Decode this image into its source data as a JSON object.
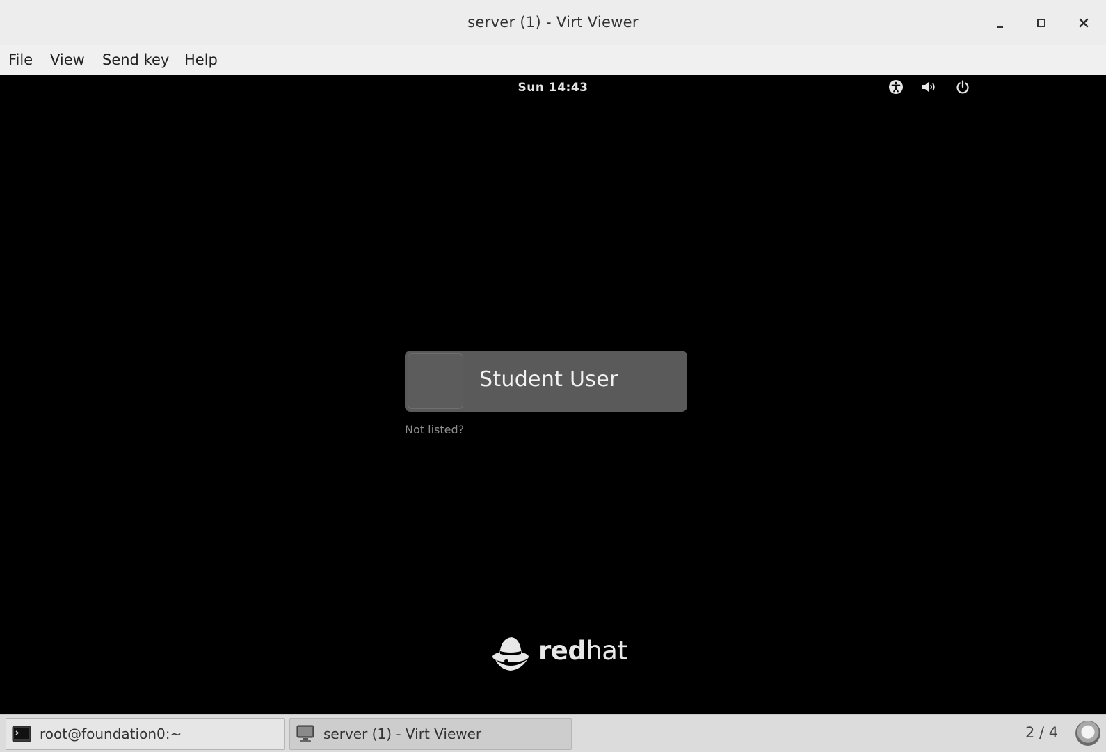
{
  "window": {
    "title": "server (1) - Virt Viewer"
  },
  "menubar": {
    "items": [
      "File",
      "View",
      "Send key",
      "Help"
    ]
  },
  "guest": {
    "clock": "Sun 14:43",
    "status_icons": [
      "accessibility-icon",
      "volume-icon",
      "power-icon"
    ],
    "user_card": {
      "name": "Student User"
    },
    "not_listed": "Not listed?",
    "logo": {
      "bold": "red",
      "regular": "hat",
      "colors": {
        "text": "#e8e8e8"
      }
    }
  },
  "taskbar": {
    "tasks": [
      {
        "label": "root@foundation0:~",
        "icon": "terminal-icon"
      },
      {
        "label": "server (1) - Virt Viewer",
        "icon": "monitor-icon"
      }
    ],
    "workspace": "2 / 4"
  },
  "colors": {
    "titlebar_bg": "#ededed",
    "guest_bg": "#000000",
    "user_card_bg": "#5a5a5a",
    "taskbar_bg": "#dcdcdc"
  }
}
